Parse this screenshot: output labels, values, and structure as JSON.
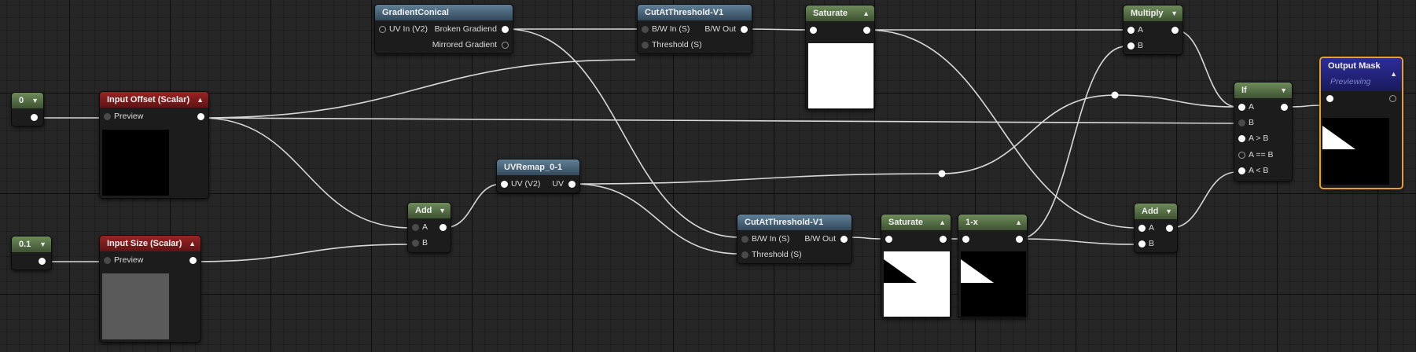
{
  "colors": {
    "canvas_background": "#262626",
    "scalar_header": "#8a2020",
    "function_header": "#5a7690",
    "math_header": "#607f50",
    "output_header": "#24248c",
    "output_border": "#e8a020",
    "wire": "#d8d8d8"
  },
  "icons": {
    "collapse": "triangle-up-icon",
    "expand": "triangle-down-icon",
    "pin": "pin-dot-icon"
  },
  "nodes": {
    "const_0": {
      "title": "0"
    },
    "const_01": {
      "title": "0.1"
    },
    "input_offset": {
      "title": "Input Offset (Scalar)",
      "preview_label": "Preview"
    },
    "input_size": {
      "title": "Input Size (Scalar)",
      "preview_label": "Preview"
    },
    "add1": {
      "title": "Add",
      "a_label": "A",
      "b_label": "B"
    },
    "uvremap": {
      "title": "UVRemap_0-1",
      "in_label": "UV (V2)",
      "out_label": "UV"
    },
    "gradient": {
      "title": "GradientConical",
      "in_label": "UV In (V2)",
      "out1_label": "Broken Gradiend",
      "out2_label": "Mirrored Gradient"
    },
    "cut_top": {
      "title": "CutAtThreshold-V1",
      "in1_label": "B/W In (S)",
      "out_label": "B/W Out",
      "in2_label": "Threshold (S)"
    },
    "cut_bottom": {
      "title": "CutAtThreshold-V1",
      "in1_label": "B/W In (S)",
      "out_label": "B/W Out",
      "in2_label": "Threshold (S)"
    },
    "sat_top": {
      "title": "Saturate"
    },
    "sat_bottom": {
      "title": "Saturate"
    },
    "oneminus": {
      "title": "1-x"
    },
    "multiply": {
      "title": "Multiply",
      "a_label": "A",
      "b_label": "B"
    },
    "add2": {
      "title": "Add",
      "a_label": "A",
      "b_label": "B"
    },
    "if_node": {
      "title": "If",
      "a_label": "A",
      "b_label": "B",
      "agtb_label": "A > B",
      "aeqb_label": "A == B",
      "altb_label": "A < B"
    },
    "output": {
      "title": "Output Mask",
      "subtitle": "Previewing"
    }
  }
}
